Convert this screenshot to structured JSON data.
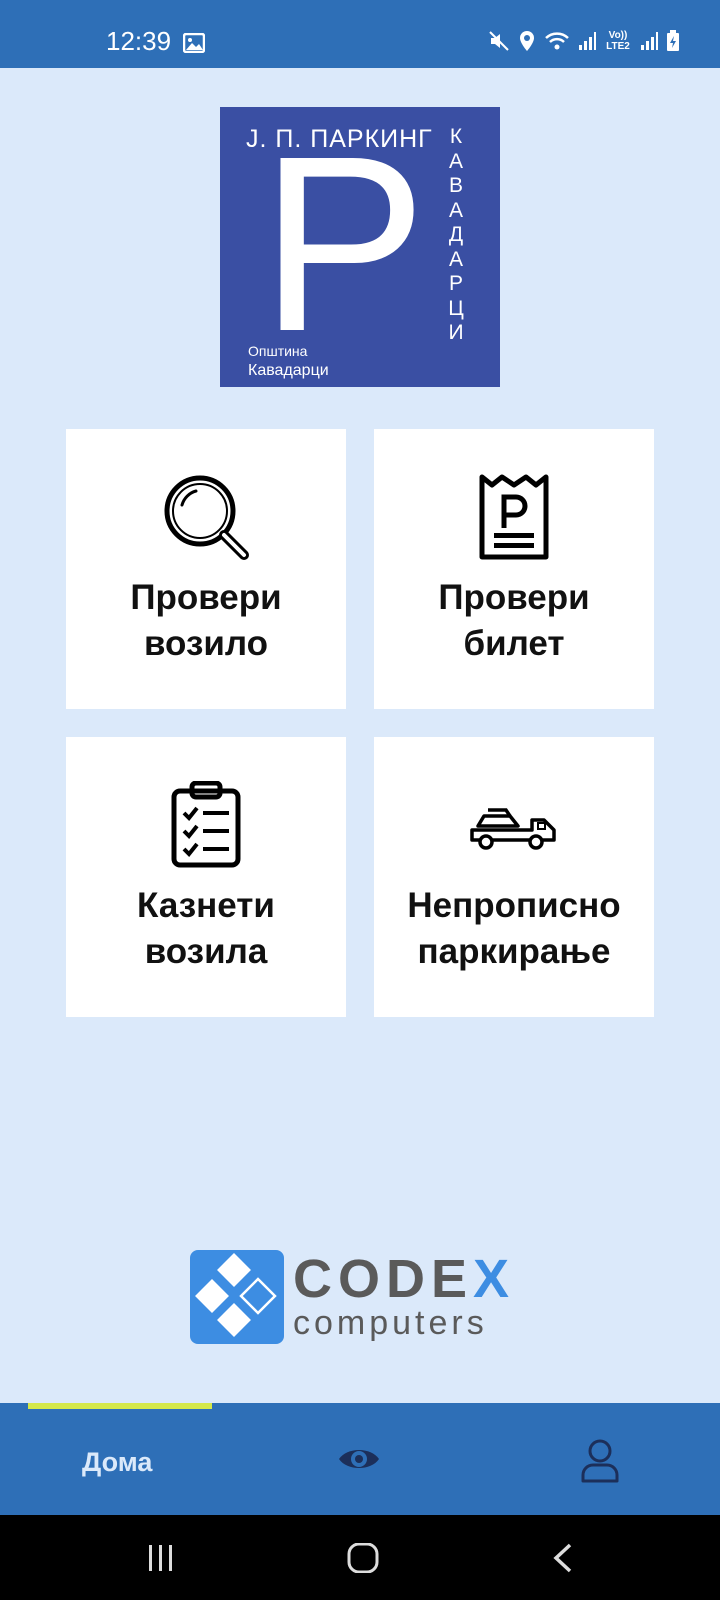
{
  "status_bar": {
    "time": "12:39",
    "network": "Vo)) LTE2"
  },
  "logo": {
    "brand_line": "Ј. П. ПАРКИНГ",
    "letter": "P",
    "vertical_letters": [
      "К",
      "А",
      "В",
      "А",
      "Д",
      "А",
      "Р",
      "Ц",
      "И"
    ],
    "municipality_label": "Општина",
    "municipality_name": "Кавадарци"
  },
  "tiles": [
    {
      "line1": "Провери",
      "line2": "возило",
      "icon": "magnifier-icon"
    },
    {
      "line1": "Провери",
      "line2": "билет",
      "icon": "parking-ticket-icon"
    },
    {
      "line1": "Казнети",
      "line2": "возила",
      "icon": "clipboard-checklist-icon"
    },
    {
      "line1": "Непрописно",
      "line2": "паркирање",
      "icon": "tow-truck-icon"
    }
  ],
  "footer_logo": {
    "word1": "CODE",
    "word1_accent": "X",
    "word2": "computers"
  },
  "bottom_nav": {
    "home_label": "Дома",
    "icons": [
      "eye-icon",
      "user-icon"
    ]
  },
  "colors": {
    "bar": "#2e6fb7",
    "background": "#dbe9fa",
    "logo_bg": "#3a4fa3",
    "indicator": "#d4e84a"
  }
}
